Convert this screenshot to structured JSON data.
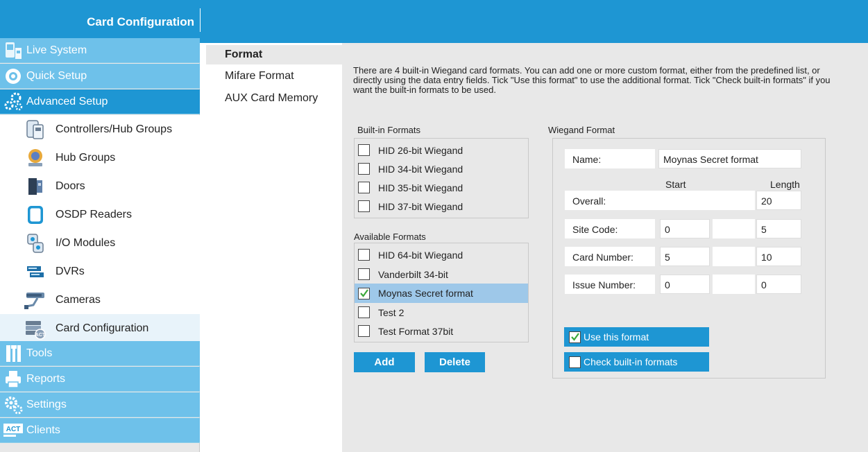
{
  "header": {
    "title": "Card Configuration"
  },
  "sidebar": {
    "nav": [
      {
        "label": "Live System",
        "icon": "live-system-icon"
      },
      {
        "label": "Quick Setup",
        "icon": "quick-setup-icon"
      },
      {
        "label": "Advanced Setup",
        "icon": "gears-icon"
      }
    ],
    "sub": [
      {
        "label": "Controllers/Hub Groups",
        "icon": "controller-icon"
      },
      {
        "label": "Hub Groups",
        "icon": "hub-icon"
      },
      {
        "label": "Doors",
        "icon": "door-icon"
      },
      {
        "label": "OSDP Readers",
        "icon": "reader-icon"
      },
      {
        "label": "I/O Modules",
        "icon": "io-module-icon"
      },
      {
        "label": "DVRs",
        "icon": "dvr-icon"
      },
      {
        "label": "Cameras",
        "icon": "camera-icon"
      },
      {
        "label": "Card Configuration",
        "icon": "card-config-icon"
      }
    ],
    "nav2": [
      {
        "label": "Tools",
        "icon": "tools-icon"
      },
      {
        "label": "Reports",
        "icon": "printer-icon"
      },
      {
        "label": "Settings",
        "icon": "settings-icon"
      },
      {
        "label": "Clients",
        "icon": "act-logo-icon"
      }
    ]
  },
  "subnav": [
    "Format",
    "Mifare Format",
    "AUX Card Memory"
  ],
  "content": {
    "description": "There are 4 built-in Wiegand card formats. You can add one or more custom format, either from the predefined list, or directly using the data entry fields. Tick \"Use this format\" to use the additional format. Tick \"Check built-in formats\" if you want the built-in formats to be used.",
    "builtin_label": "Built-in Formats",
    "builtin": [
      "HID 26-bit Wiegand",
      "HID 34-bit Wiegand",
      "HID 35-bit Wiegand",
      "HID 37-bit Wiegand"
    ],
    "available_label": "Available Formats",
    "available": [
      "HID 64-bit Wiegand",
      "Vanderbilt 34-bit",
      "Moynas Secret format",
      "Test 2",
      "Test Format 37bit"
    ],
    "add_label": "Add",
    "delete_label": "Delete",
    "wiegand": {
      "title": "Wiegand Format",
      "name_label": "Name:",
      "name_value": "Moynas Secret format",
      "start_label": "Start",
      "length_label": "Length",
      "overall_label": "Overall:",
      "overall_length": "20",
      "site_label": "Site Code:",
      "site_start": "0",
      "site_length": "5",
      "card_label": "Card Number:",
      "card_start": "5",
      "card_length": "10",
      "issue_label": "Issue Number:",
      "issue_start": "0",
      "issue_length": "0",
      "use_label": "Use this format",
      "check_label": "Check built-in formats"
    }
  }
}
